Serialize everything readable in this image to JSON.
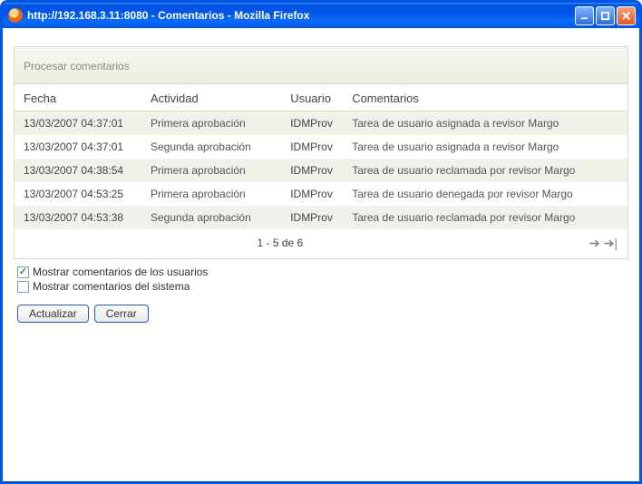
{
  "window": {
    "title": "http://192.168.3.11:8080 - Comentarios - Mozilla Firefox"
  },
  "panel": {
    "title": "Procesar comentarios"
  },
  "columns": {
    "fecha": "Fecha",
    "actividad": "Actividad",
    "usuario": "Usuario",
    "comentarios": "Comentarios"
  },
  "rows": [
    {
      "fecha": "13/03/2007 04:37:01",
      "actividad": "Primera aprobación",
      "usuario": "IDMProv",
      "comentario": "Tarea de usuario asignada a revisor Margo"
    },
    {
      "fecha": "13/03/2007 04:37:01",
      "actividad": "Segunda aprobación",
      "usuario": "IDMProv",
      "comentario": "Tarea de usuario asignada a revisor Margo"
    },
    {
      "fecha": "13/03/2007 04:38:54",
      "actividad": "Primera aprobación",
      "usuario": "IDMProv",
      "comentario": "Tarea de usuario reclamada por revisor Margo"
    },
    {
      "fecha": "13/03/2007 04:53:25",
      "actividad": "Primera aprobación",
      "usuario": "IDMProv",
      "comentario": "Tarea de usuario denegada por revisor Margo"
    },
    {
      "fecha": "13/03/2007 04:53:38",
      "actividad": "Segunda aprobación",
      "usuario": "IDMProv",
      "comentario": "Tarea de usuario reclamada por revisor Margo"
    }
  ],
  "pager": {
    "text": "1 - 5 de 6"
  },
  "checks": {
    "users": {
      "label": "Mostrar comentarios de los usuarios",
      "checked": true
    },
    "system": {
      "label": "Mostrar comentarios del sistema",
      "checked": false
    }
  },
  "buttons": {
    "refresh": "Actualizar",
    "close": "Cerrar"
  }
}
